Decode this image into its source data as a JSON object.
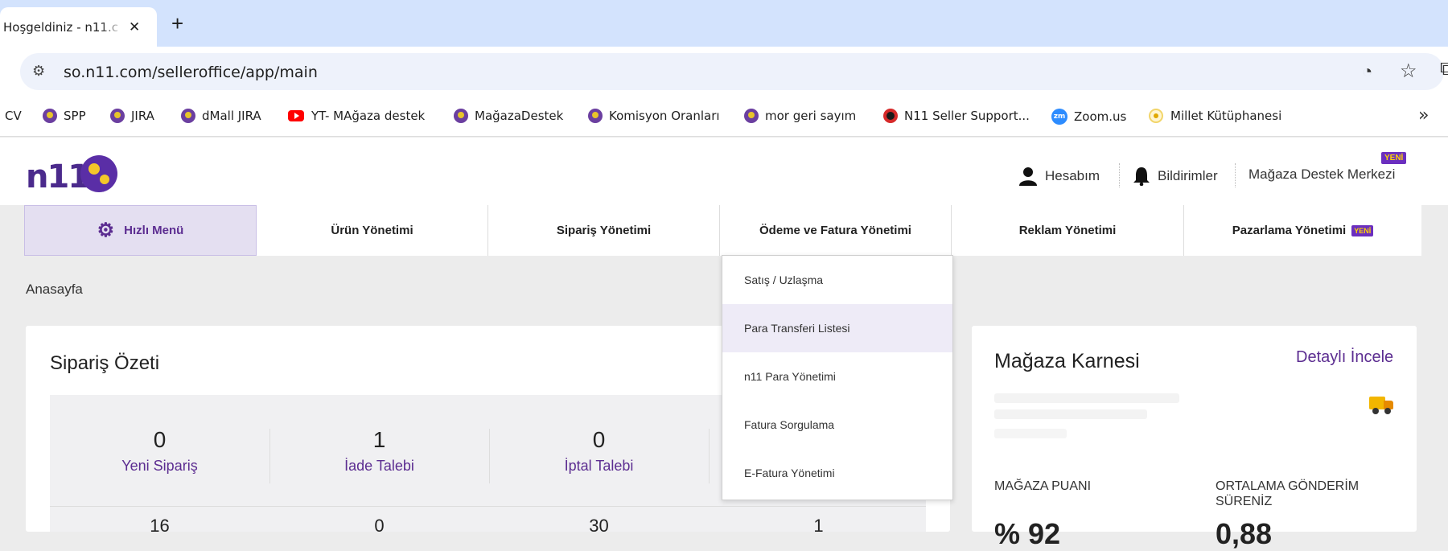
{
  "browser": {
    "tab_title": "Hoşgeldiniz - n11.c",
    "close_glyph": "✕",
    "new_tab_glyph": "+",
    "url": "so.n11.com/selleroffice/app/main",
    "bookmarks": [
      {
        "label": "CV",
        "icon": "none"
      },
      {
        "label": "SPP",
        "icon": "n11-bug-icon"
      },
      {
        "label": "JIRA",
        "icon": "n11-bug-icon"
      },
      {
        "label": "dMall JIRA",
        "icon": "n11-bug-icon"
      },
      {
        "label": "YT- MAğaza destek",
        "icon": "youtube-icon"
      },
      {
        "label": "MağazaDestek",
        "icon": "n11-bug-icon"
      },
      {
        "label": "Komisyon Oranları",
        "icon": "n11-bug-icon"
      },
      {
        "label": "mor geri sayım",
        "icon": "n11-bug-icon"
      },
      {
        "label": "N11 Seller Support...",
        "icon": "ladybug-icon"
      },
      {
        "label": "Zoom.us",
        "icon": "zoom-icon"
      },
      {
        "label": "Millet Kütüphanesi",
        "icon": "library-icon"
      }
    ],
    "more_glyph": "»"
  },
  "header": {
    "logo_text": "n11",
    "account": "Hesabım",
    "notifications": "Bildirimler",
    "support": "Mağaza Destek Merkezi",
    "support_badge": "YENİ"
  },
  "nav": {
    "items": [
      {
        "label": "Hızlı Menü"
      },
      {
        "label": "Ürün Yönetimi"
      },
      {
        "label": "Sipariş Yönetimi"
      },
      {
        "label": "Ödeme ve Fatura Yönetimi"
      },
      {
        "label": "Reklam Yönetimi"
      },
      {
        "label": "Pazarlama Yönetimi",
        "badge": "YENİ"
      }
    ]
  },
  "dropdown": {
    "items": [
      {
        "label": "Satış / Uzlaşma"
      },
      {
        "label": "Para Transferi Listesi"
      },
      {
        "label": "n11 Para Yönetimi"
      },
      {
        "label": "Fatura Sorgulama"
      },
      {
        "label": "E-Fatura Yönetimi"
      }
    ]
  },
  "breadcrumb": "Anasayfa",
  "order_summary": {
    "title": "Sipariş Özeti",
    "stats": [
      {
        "value": "0",
        "label": "Yeni Sipariş"
      },
      {
        "value": "1",
        "label": "İade Talebi"
      },
      {
        "value": "0",
        "label": "İptal Talebi"
      }
    ],
    "second_row": [
      "16",
      "0",
      "30",
      "1"
    ]
  },
  "store_card": {
    "title": "Mağaza Karnesi",
    "detail_link": "Detaylı İncele",
    "score_label": "MAĞAZA PUANI",
    "score_value": "% 92",
    "ship_label_1": "ORTALAMA GÖNDERİM",
    "ship_label_2": "SÜRENİZ",
    "ship_value": "0,88"
  },
  "colors": {
    "brand": "#5c2d91",
    "badge_bg": "#6b2fbf",
    "badge_text": "#ffd400"
  }
}
